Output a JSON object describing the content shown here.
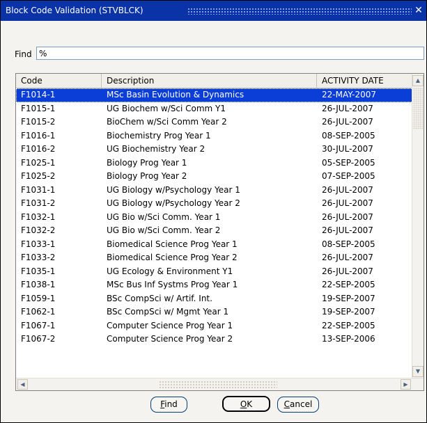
{
  "window": {
    "title": "Block Code Validation (STVBLCK)",
    "close_glyph": "✕"
  },
  "search": {
    "label": "Find",
    "value": "%"
  },
  "table": {
    "columns": [
      "Code",
      "Description",
      "ACTIVITY DATE"
    ],
    "selected_index": 0,
    "rows": [
      {
        "code": "F1014-1",
        "description": "MSc Basin Evolution & Dynamics",
        "date": "22-MAY-2007"
      },
      {
        "code": "F1015-1",
        "description": "UG Biochem w/Sci Comm Y1",
        "date": "26-JUL-2007"
      },
      {
        "code": "F1015-2",
        "description": "BioChem w/Sci Comm Year 2",
        "date": "26-JUL-2007"
      },
      {
        "code": "F1016-1",
        "description": "Biochemistry Prog Year 1",
        "date": "08-SEP-2005"
      },
      {
        "code": "F1016-2",
        "description": "UG Biochemistry Year 2",
        "date": "30-JUL-2007"
      },
      {
        "code": "F1025-1",
        "description": "Biology Prog Year 1",
        "date": "05-SEP-2005"
      },
      {
        "code": "F1025-2",
        "description": "Biology Prog Year 2",
        "date": "07-SEP-2005"
      },
      {
        "code": "F1031-1",
        "description": "UG Biology w/Psychology Year 1",
        "date": "26-JUL-2007"
      },
      {
        "code": "F1031-2",
        "description": "UG Biology w/Psychology Year 2",
        "date": "26-JUL-2007"
      },
      {
        "code": "F1032-1",
        "description": "UG Bio w/Sci Comm. Year 1",
        "date": "26-JUL-2007"
      },
      {
        "code": "F1032-2",
        "description": "UG Bio w/Sci Comm. Year 2",
        "date": "26-JUL-2007"
      },
      {
        "code": "F1033-1",
        "description": "Biomedical Science Prog Year 1",
        "date": "08-SEP-2005"
      },
      {
        "code": "F1033-2",
        "description": "Biomedical Science Prog Year 2",
        "date": "26-JUL-2007"
      },
      {
        "code": "F1035-1",
        "description": "UG Ecology & Environment Y1",
        "date": "26-JUL-2007"
      },
      {
        "code": "F1038-1",
        "description": "MSc Bus Inf Systms Prog Year 1",
        "date": "22-SEP-2005"
      },
      {
        "code": "F1059-1",
        "description": "BSc CompSci w/ Artif. Int.",
        "date": "19-SEP-2007"
      },
      {
        "code": "F1062-1",
        "description": "BSc CompSci w/ Mgmt Year 1",
        "date": "19-SEP-2007"
      },
      {
        "code": "F1067-1",
        "description": "Computer Science Prog Year 1",
        "date": "22-SEP-2005"
      },
      {
        "code": "F1067-2",
        "description": "Computer Science Prog Year 2",
        "date": "13-SEP-2006"
      }
    ]
  },
  "buttons": {
    "find": {
      "mnemonic": "F",
      "rest": "ind"
    },
    "ok": {
      "mnemonic": "O",
      "rest": "K"
    },
    "cancel": {
      "mnemonic": "C",
      "rest": "ancel"
    }
  },
  "colors": {
    "titlebar": "#0a33a8",
    "selection": "#0b3ed6"
  },
  "icons": [
    "close-icon",
    "scroll-up-icon",
    "scroll-down-icon",
    "scroll-left-icon",
    "scroll-right-icon"
  ]
}
